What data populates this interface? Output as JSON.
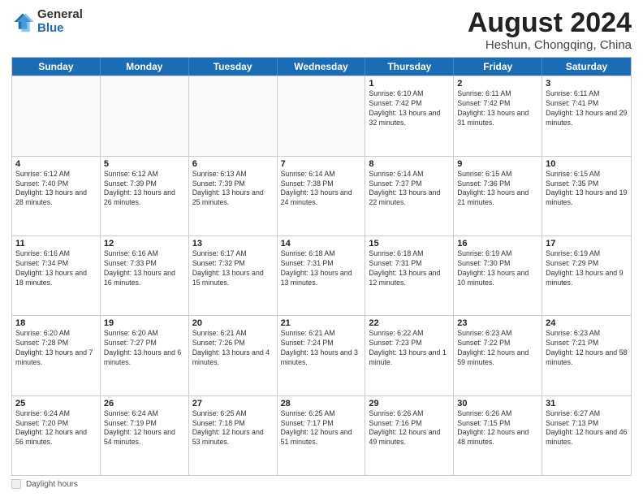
{
  "logo": {
    "general": "General",
    "blue": "Blue"
  },
  "title": {
    "month_year": "August 2024",
    "location": "Heshun, Chongqing, China"
  },
  "days_of_week": [
    "Sunday",
    "Monday",
    "Tuesday",
    "Wednesday",
    "Thursday",
    "Friday",
    "Saturday"
  ],
  "weeks": [
    [
      {
        "day": "",
        "info": ""
      },
      {
        "day": "",
        "info": ""
      },
      {
        "day": "",
        "info": ""
      },
      {
        "day": "",
        "info": ""
      },
      {
        "day": "1",
        "info": "Sunrise: 6:10 AM\nSunset: 7:42 PM\nDaylight: 13 hours and 32 minutes."
      },
      {
        "day": "2",
        "info": "Sunrise: 6:11 AM\nSunset: 7:42 PM\nDaylight: 13 hours and 31 minutes."
      },
      {
        "day": "3",
        "info": "Sunrise: 6:11 AM\nSunset: 7:41 PM\nDaylight: 13 hours and 29 minutes."
      }
    ],
    [
      {
        "day": "4",
        "info": "Sunrise: 6:12 AM\nSunset: 7:40 PM\nDaylight: 13 hours and 28 minutes."
      },
      {
        "day": "5",
        "info": "Sunrise: 6:12 AM\nSunset: 7:39 PM\nDaylight: 13 hours and 26 minutes."
      },
      {
        "day": "6",
        "info": "Sunrise: 6:13 AM\nSunset: 7:39 PM\nDaylight: 13 hours and 25 minutes."
      },
      {
        "day": "7",
        "info": "Sunrise: 6:14 AM\nSunset: 7:38 PM\nDaylight: 13 hours and 24 minutes."
      },
      {
        "day": "8",
        "info": "Sunrise: 6:14 AM\nSunset: 7:37 PM\nDaylight: 13 hours and 22 minutes."
      },
      {
        "day": "9",
        "info": "Sunrise: 6:15 AM\nSunset: 7:36 PM\nDaylight: 13 hours and 21 minutes."
      },
      {
        "day": "10",
        "info": "Sunrise: 6:15 AM\nSunset: 7:35 PM\nDaylight: 13 hours and 19 minutes."
      }
    ],
    [
      {
        "day": "11",
        "info": "Sunrise: 6:16 AM\nSunset: 7:34 PM\nDaylight: 13 hours and 18 minutes."
      },
      {
        "day": "12",
        "info": "Sunrise: 6:16 AM\nSunset: 7:33 PM\nDaylight: 13 hours and 16 minutes."
      },
      {
        "day": "13",
        "info": "Sunrise: 6:17 AM\nSunset: 7:32 PM\nDaylight: 13 hours and 15 minutes."
      },
      {
        "day": "14",
        "info": "Sunrise: 6:18 AM\nSunset: 7:31 PM\nDaylight: 13 hours and 13 minutes."
      },
      {
        "day": "15",
        "info": "Sunrise: 6:18 AM\nSunset: 7:31 PM\nDaylight: 13 hours and 12 minutes."
      },
      {
        "day": "16",
        "info": "Sunrise: 6:19 AM\nSunset: 7:30 PM\nDaylight: 13 hours and 10 minutes."
      },
      {
        "day": "17",
        "info": "Sunrise: 6:19 AM\nSunset: 7:29 PM\nDaylight: 13 hours and 9 minutes."
      }
    ],
    [
      {
        "day": "18",
        "info": "Sunrise: 6:20 AM\nSunset: 7:28 PM\nDaylight: 13 hours and 7 minutes."
      },
      {
        "day": "19",
        "info": "Sunrise: 6:20 AM\nSunset: 7:27 PM\nDaylight: 13 hours and 6 minutes."
      },
      {
        "day": "20",
        "info": "Sunrise: 6:21 AM\nSunset: 7:26 PM\nDaylight: 13 hours and 4 minutes."
      },
      {
        "day": "21",
        "info": "Sunrise: 6:21 AM\nSunset: 7:24 PM\nDaylight: 13 hours and 3 minutes."
      },
      {
        "day": "22",
        "info": "Sunrise: 6:22 AM\nSunset: 7:23 PM\nDaylight: 13 hours and 1 minute."
      },
      {
        "day": "23",
        "info": "Sunrise: 6:23 AM\nSunset: 7:22 PM\nDaylight: 12 hours and 59 minutes."
      },
      {
        "day": "24",
        "info": "Sunrise: 6:23 AM\nSunset: 7:21 PM\nDaylight: 12 hours and 58 minutes."
      }
    ],
    [
      {
        "day": "25",
        "info": "Sunrise: 6:24 AM\nSunset: 7:20 PM\nDaylight: 12 hours and 56 minutes."
      },
      {
        "day": "26",
        "info": "Sunrise: 6:24 AM\nSunset: 7:19 PM\nDaylight: 12 hours and 54 minutes."
      },
      {
        "day": "27",
        "info": "Sunrise: 6:25 AM\nSunset: 7:18 PM\nDaylight: 12 hours and 53 minutes."
      },
      {
        "day": "28",
        "info": "Sunrise: 6:25 AM\nSunset: 7:17 PM\nDaylight: 12 hours and 51 minutes."
      },
      {
        "day": "29",
        "info": "Sunrise: 6:26 AM\nSunset: 7:16 PM\nDaylight: 12 hours and 49 minutes."
      },
      {
        "day": "30",
        "info": "Sunrise: 6:26 AM\nSunset: 7:15 PM\nDaylight: 12 hours and 48 minutes."
      },
      {
        "day": "31",
        "info": "Sunrise: 6:27 AM\nSunset: 7:13 PM\nDaylight: 12 hours and 46 minutes."
      }
    ]
  ],
  "legend": {
    "label": "Daylight hours"
  },
  "colors": {
    "header_bg": "#1a6db5",
    "header_text": "#ffffff",
    "border": "#cccccc",
    "accent": "#1a6db5"
  }
}
